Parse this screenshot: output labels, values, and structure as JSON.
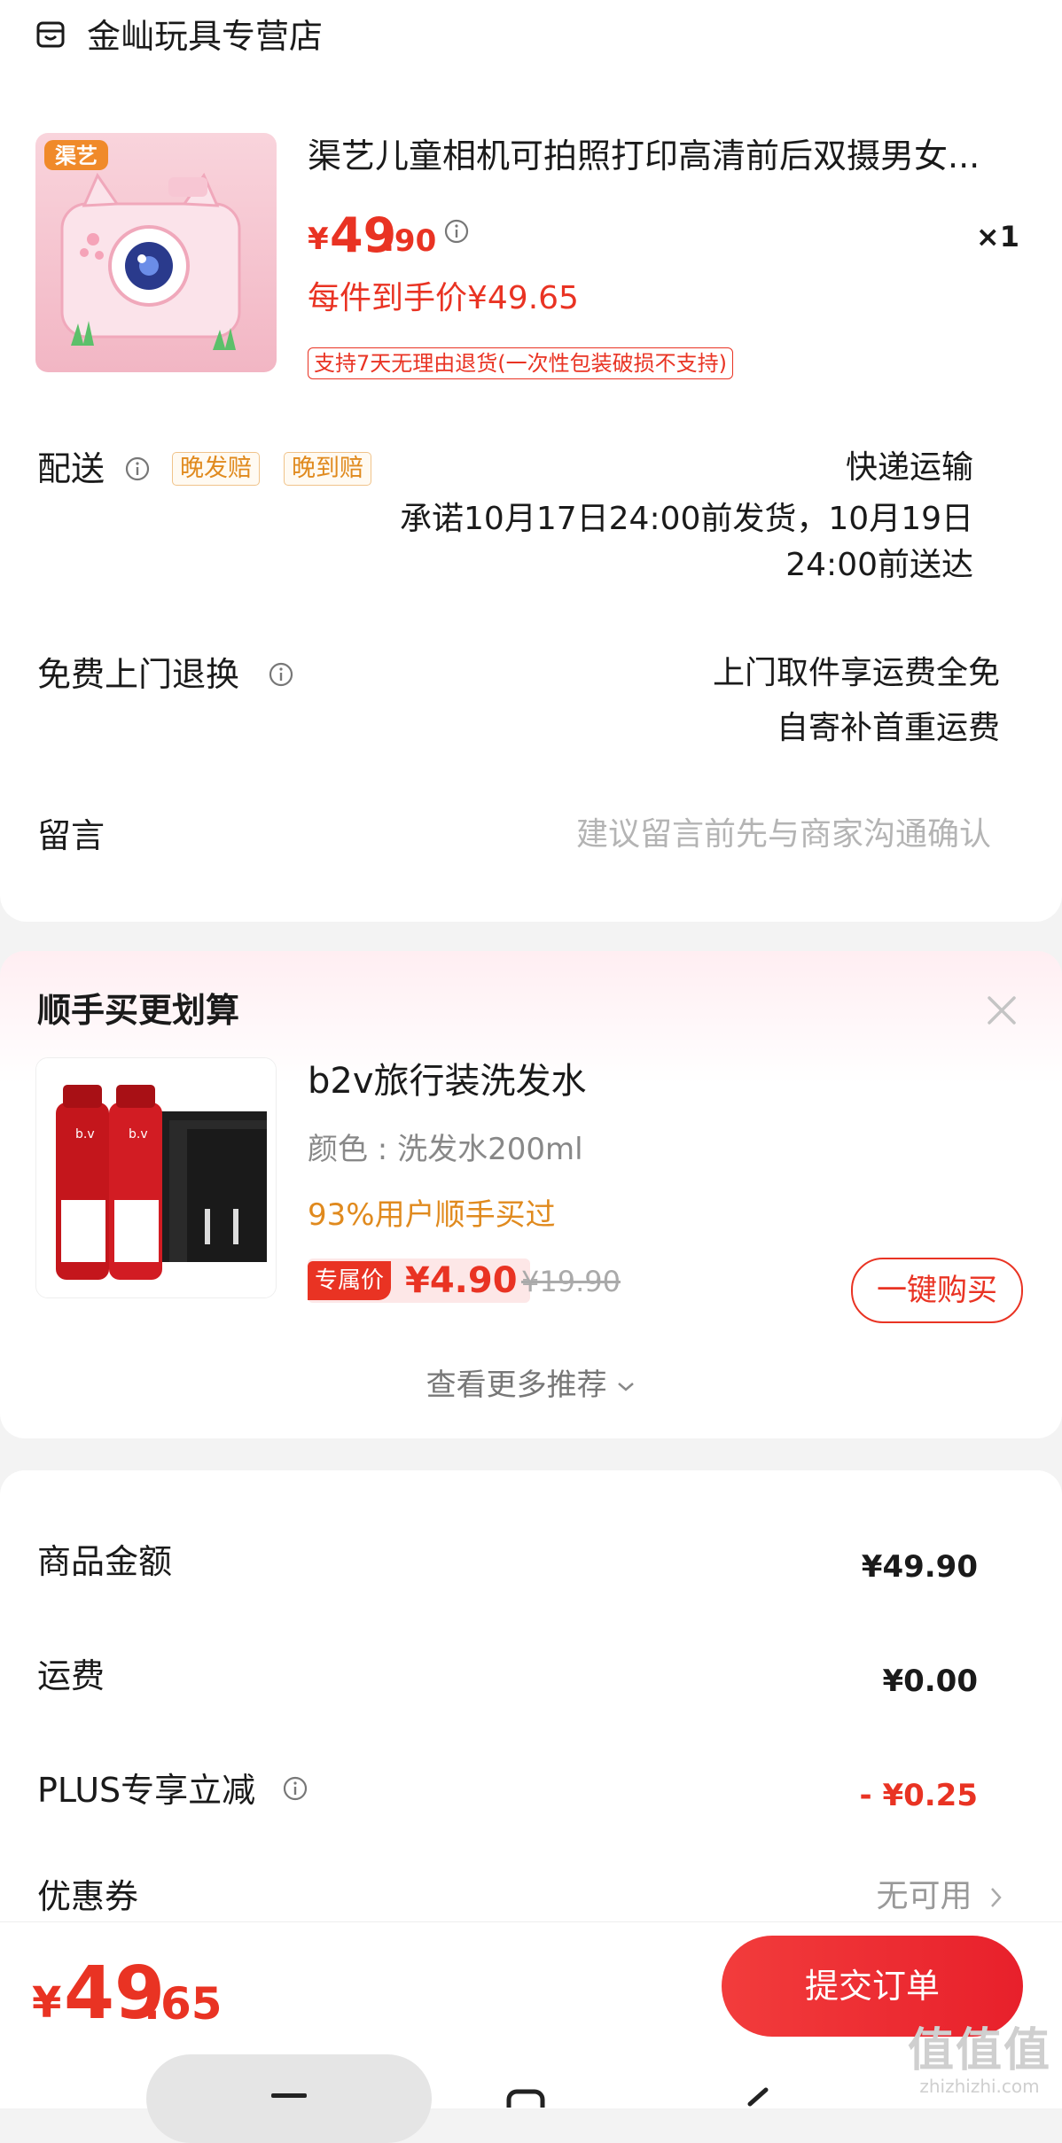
{
  "store": {
    "name": "金屾玩具专营店"
  },
  "product": {
    "brand_badge": "渠艺",
    "title": "渠艺儿童相机可拍照打印高清前后双摄男女...",
    "price_symbol": "¥",
    "price_int": "49",
    "price_dec": ".90",
    "qty": "×1",
    "hand_price": "每件到手价¥49.65",
    "return_tag": "支持7天无理由退货(一次性包装破损不支持)"
  },
  "delivery": {
    "label": "配送",
    "tags": [
      "晚发赔",
      "晚到赔"
    ],
    "method": "快递运输",
    "promise_line1": "承诺10月17日24:00前发货，10月19日",
    "promise_line2": "24:00前送达"
  },
  "free_return": {
    "label": "免费上门退换",
    "line1": "上门取件享运费全免",
    "line2": "自寄补首重运费"
  },
  "message": {
    "label": "留言",
    "placeholder": "建议留言前先与商家沟通确认"
  },
  "upsell": {
    "title": "顺手买更划算",
    "item_title": "b2v旅行装洗发水",
    "item_spec": "颜色 : 洗发水200ml",
    "item_pct": "93%用户顺手买过",
    "excl_tag": "专属价",
    "excl_price": "¥4.90",
    "orig_price": "¥19.90",
    "buy_label": "一键购买",
    "more_label": "查看更多推荐"
  },
  "summary": {
    "goods_label": "商品金额",
    "goods_value": "¥49.90",
    "shipping_label": "运费",
    "shipping_value": "¥0.00",
    "plus_label": "PLUS专享立减",
    "plus_value": "- ¥0.25",
    "coupon_label": "优惠券",
    "coupon_value": "无可用"
  },
  "footer": {
    "total_symbol": "¥",
    "total_int": "49",
    "total_dec": ".65",
    "submit_label": "提交订单"
  },
  "watermark": {
    "main": "值值值",
    "sub": "zhizhizhi.com"
  },
  "colors": {
    "accent": "#e93323",
    "orange": "#e08a1e",
    "muted": "#999999"
  },
  "icons": [
    "store-icon",
    "info-icon",
    "close-icon",
    "chevron-down-icon",
    "chevron-right-icon",
    "menu-icon",
    "home-icon",
    "back-icon"
  ]
}
